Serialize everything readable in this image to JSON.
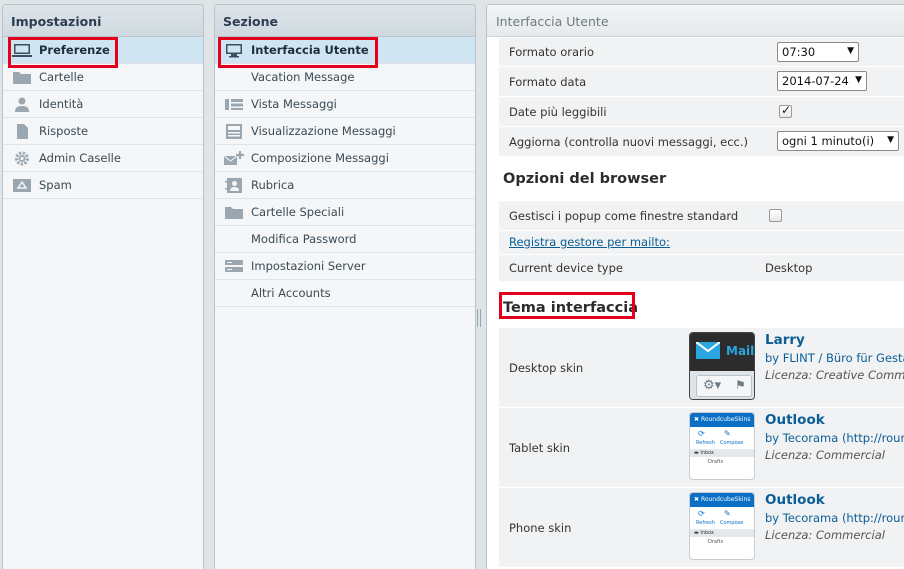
{
  "settings_panel": {
    "title": "Impostazioni",
    "items": [
      {
        "label": "Preferenze",
        "icon": "monitor-icon"
      },
      {
        "label": "Cartelle",
        "icon": "folder-icon"
      },
      {
        "label": "Identità",
        "icon": "person-icon"
      },
      {
        "label": "Risposte",
        "icon": "document-icon"
      },
      {
        "label": "Admin Caselle",
        "icon": "gear-icon"
      },
      {
        "label": "Spam",
        "icon": "recycle-icon"
      }
    ]
  },
  "section_panel": {
    "title": "Sezione",
    "items": [
      {
        "label": "Interfaccia Utente",
        "icon": "monitor-icon"
      },
      {
        "label": "Vacation Message",
        "icon": ""
      },
      {
        "label": "Vista Messaggi",
        "icon": "list-view-icon"
      },
      {
        "label": "Visualizzazione Messaggi",
        "icon": "message-view-icon"
      },
      {
        "label": "Composizione Messaggi",
        "icon": "compose-icon"
      },
      {
        "label": "Rubrica",
        "icon": "address-book-icon"
      },
      {
        "label": "Cartelle Speciali",
        "icon": "folder-icon"
      },
      {
        "label": "Modifica Password",
        "icon": ""
      },
      {
        "label": "Impostazioni Server",
        "icon": "server-icon"
      },
      {
        "label": "Altri Accounts",
        "icon": ""
      }
    ]
  },
  "main": {
    "title": "Interfaccia Utente",
    "general_rows": {
      "time_format": {
        "label": "Formato orario",
        "value": "07:30"
      },
      "date_format": {
        "label": "Formato data",
        "value": "2014-07-24"
      },
      "pretty_date": {
        "label": "Date più leggibili",
        "checked": true
      },
      "refresh": {
        "label": "Aggiorna (controlla nuovi messaggi, ecc.)",
        "value": "ogni 1 minuto(i)"
      }
    },
    "browser_section": {
      "title": "Opzioni del browser",
      "popup": {
        "label": "Gestisci i popup come finestre standard",
        "checked": false
      },
      "mailto_link": "Registra gestore per mailto:",
      "device": {
        "label": "Current device type",
        "value": "Desktop"
      }
    },
    "skin_section": {
      "title": "Tema interfaccia",
      "skins": [
        {
          "label": "Desktop skin",
          "name": "Larry",
          "author": "by FLINT / Büro für Gestaltung",
          "license": "Licenza: Creative Commons",
          "thumb_text": "Mail"
        },
        {
          "label": "Tablet skin",
          "name": "Outlook",
          "author": "by Tecorama (http://roundcubeskins.net)",
          "license": "Licenza: Commercial",
          "thumb_text": "RoundcubeSkins",
          "thumb_buttons": [
            "Refresh",
            "Compose"
          ],
          "thumb_folders": [
            "Inbox",
            "Drafts"
          ]
        },
        {
          "label": "Phone skin",
          "name": "Outlook",
          "author": "by Tecorama (http://roundcubeskins.net)",
          "license": "Licenza: Commercial",
          "thumb_text": "RoundcubeSkins",
          "thumb_buttons": [
            "Refresh",
            "Compose"
          ],
          "thumb_folders": [
            "Inbox",
            "Drafts"
          ]
        }
      ]
    }
  },
  "colors": {
    "highlight": "#e4001b",
    "link": "#0a5d95",
    "selected": "#cfe6f2"
  }
}
